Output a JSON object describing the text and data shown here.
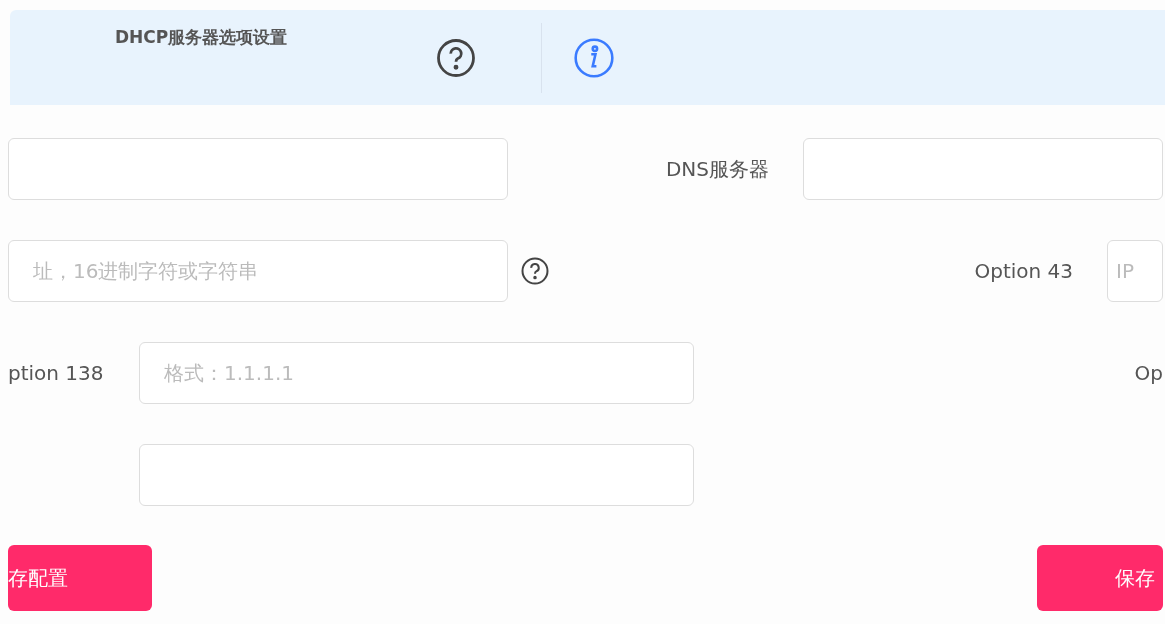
{
  "header": {
    "title": "DHCP服务器选项设置"
  },
  "rows": [
    {
      "left": {
        "kind": "wide"
      },
      "right": {
        "kind": "label_field",
        "label": "DNS服务器"
      }
    },
    {
      "left": {
        "kind": "wide_help",
        "placeholder": "址，16进制字符或字符串"
      },
      "right": {
        "kind": "label_field",
        "label": "Option 43",
        "placeholder": "IP"
      }
    },
    {
      "left": {
        "kind": "labeled",
        "label": "ption 138",
        "placeholder": "格式：1.1.1.1"
      },
      "right": {
        "kind": "label",
        "label": "Op"
      }
    },
    {
      "left": {
        "kind": "field_only"
      }
    }
  ],
  "buttons": [
    {
      "label": "存配置"
    },
    {
      "label": "保存"
    }
  ]
}
